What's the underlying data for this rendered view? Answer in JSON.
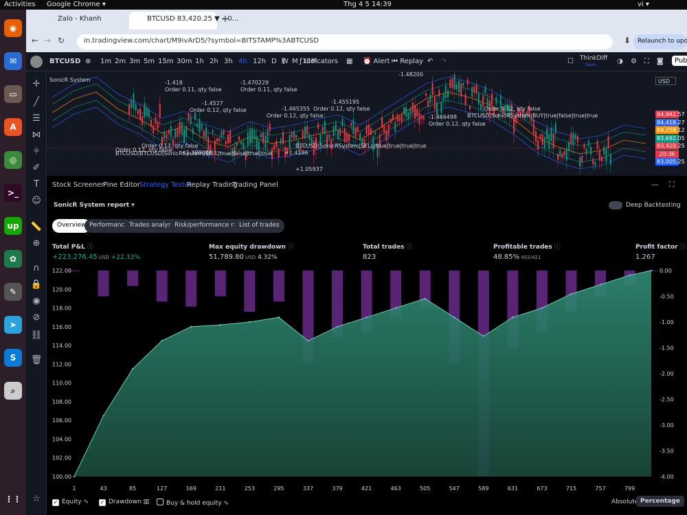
{
  "system": {
    "activities": "Activities",
    "app": "Google Chrome ▾",
    "clock": "Thg 4 5  14:39",
    "lang": "vi ▾"
  },
  "browser": {
    "tabs": [
      {
        "label": "Zalo - Khanh"
      },
      {
        "label": "BTCUSD 83,420.25 ▼ −0…"
      }
    ],
    "url": "in.tradingview.com/chart/M9ivArD5/?symbol=BITSTAMP%3ABTCUSD",
    "relaunch": "Relaunch to update"
  },
  "toolbar": {
    "symbol": "BTCUSD",
    "intervals": [
      "1m",
      "2m",
      "3m",
      "5m",
      "15m",
      "30m",
      "1h",
      "2h",
      "3h",
      "4h",
      "12h",
      "D",
      "W",
      "M",
      "12M"
    ],
    "active_interval": "4h",
    "indicators": "Indicators",
    "alert": "Alert",
    "replay": "Replay",
    "brand": "ThinkDiff",
    "brand_sub": "Save",
    "publish": "Publ"
  },
  "chart": {
    "indicator_name": "SonicR System",
    "currency": "USD",
    "annotations": [
      "-1.418",
      "Order 0.11, qty false",
      "-1.470229",
      "Order 0.11, qty false",
      "-1.4527",
      "Order 0.12, qty false",
      "-1.455195",
      "Order 0.12, qty false",
      "-1.465355",
      "Order 0.12, qty false",
      "-1.48200",
      "Order 0.12, qty false",
      "BTCUSD|SonicRSystem|BUY|true|false|true|true",
      "-1.466498",
      "Order 0.12, qty false",
      "Order 0.11, qty false",
      "+1.390088",
      "BTCUSD|SonicRSystem|SELL|true|true|true|true",
      "+1.4186",
      "+1.05937",
      "Order 0.12, qty false",
      "BTCUSD|BTCUSD|SonicRSystem|SELL|true|false|true|true"
    ],
    "price_tags": [
      {
        "value": "84,942.57",
        "color": "#f23645"
      },
      {
        "value": "84,418.27",
        "color": "#2962ff"
      },
      {
        "value": "84,258.12",
        "color": "#ff9800"
      },
      {
        "value": "83,692.05",
        "color": "#089981"
      },
      {
        "value": "83,420.25",
        "color": "#f23645"
      },
      {
        "value": "20:36",
        "color": "#f23645"
      },
      {
        "value": "83,005.25",
        "color": "#2962ff"
      }
    ]
  },
  "panel": {
    "tabs": [
      "Stock Screener",
      "Pine Editor",
      "Strategy Tester",
      "Replay Trading",
      "Trading Panel"
    ],
    "active_tab": "Strategy Tester",
    "report_title": "SonicR System report",
    "deep_backtesting": "Deep Backtesting",
    "subtabs": [
      "Overview",
      "Performance",
      "Trades analysis",
      "Risk/performance ratios",
      "List of trades"
    ],
    "active_subtab": "Overview",
    "metrics": [
      {
        "label": "Total P&L",
        "value": "+223,276.45",
        "unit": "USD",
        "extra": "+22.33%",
        "color": "#22ab94"
      },
      {
        "label": "Max equity drawdown",
        "value": "51,789.80",
        "unit": "USD",
        "extra": "4.32%",
        "color": "#d1d4dc"
      },
      {
        "label": "Total trades",
        "value": "823",
        "unit": "",
        "extra": "",
        "color": "#d1d4dc"
      },
      {
        "label": "Profitable trades",
        "value": "48.85%",
        "unit": "402/421",
        "extra": "",
        "color": "#d1d4dc"
      },
      {
        "label": "Profit factor",
        "value": "1.267",
        "unit": "",
        "extra": "",
        "color": "#d1d4dc"
      }
    ],
    "legend": {
      "equity": "Equity",
      "drawdown": "Drawdown",
      "buyhold": "Buy & hold equity",
      "absolute": "Absolute",
      "percentage": "Percentage"
    }
  },
  "chart_data": {
    "type": "area",
    "y_left_ticks": [
      "122.00",
      "120.00",
      "118.00",
      "116.00",
      "114.00",
      "112.00",
      "110.00",
      "108.00",
      "106.00",
      "104.00",
      "102.00",
      "100.00"
    ],
    "y_right_ticks": [
      "0.00",
      "-0.50",
      "-1.00",
      "-1.50",
      "-2.00",
      "-2.50",
      "-3.00",
      "-3.50",
      "-4.00"
    ],
    "x_ticks": [
      "1",
      "43",
      "85",
      "127",
      "169",
      "211",
      "253",
      "295",
      "337",
      "379",
      "421",
      "463",
      "505",
      "547",
      "589",
      "631",
      "673",
      "715",
      "757",
      "799"
    ],
    "x": [
      1,
      43,
      85,
      127,
      169,
      211,
      253,
      295,
      337,
      379,
      421,
      463,
      505,
      547,
      589,
      631,
      673,
      715,
      757,
      799,
      830
    ],
    "equity": [
      100.0,
      106.5,
      111.5,
      114.5,
      116.0,
      116.2,
      116.5,
      117.0,
      114.5,
      116.0,
      117.0,
      118.0,
      119.0,
      117.0,
      115.0,
      117.0,
      118.0,
      119.5,
      120.5,
      121.5,
      122.0
    ],
    "drawdown": [
      0.0,
      -0.5,
      -0.3,
      -0.6,
      -0.7,
      -0.5,
      -0.8,
      -0.6,
      -1.8,
      -1.3,
      -1.2,
      -0.9,
      -0.7,
      -1.8,
      -4.0,
      -1.5,
      -1.2,
      -0.8,
      -0.5,
      -0.3,
      0.0
    ],
    "ylim_left": [
      100,
      122
    ],
    "ylim_right": [
      -4.0,
      0.0
    ]
  }
}
